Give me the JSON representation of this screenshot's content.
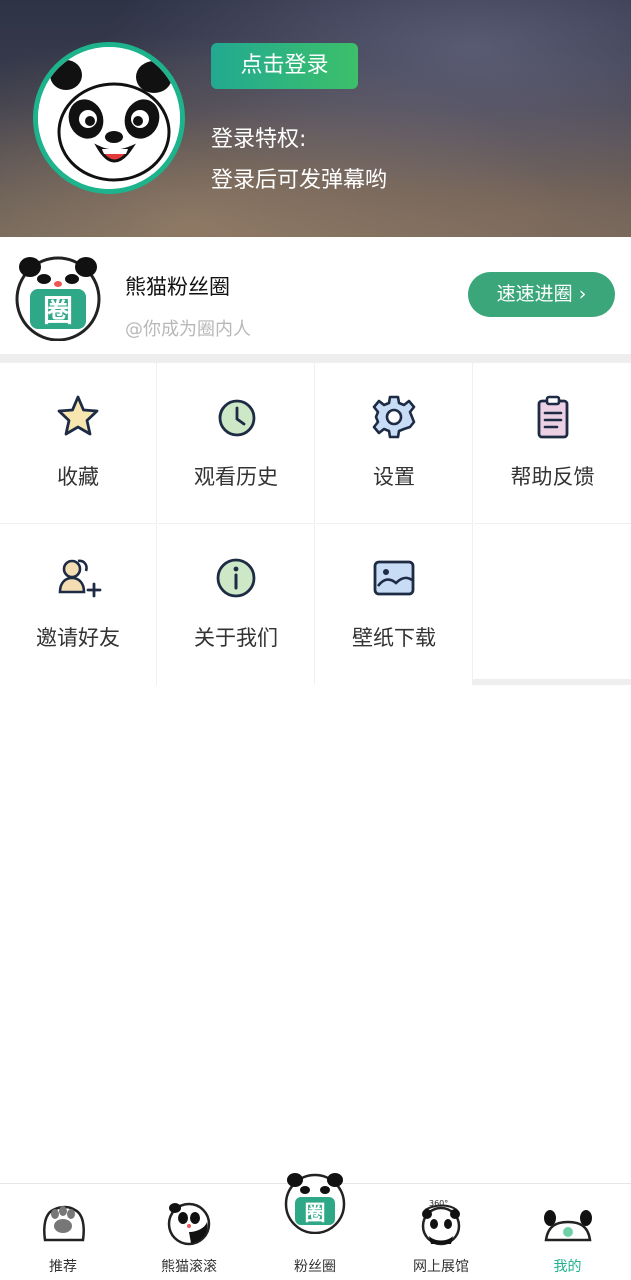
{
  "header": {
    "login_button": "点击登录",
    "privilege_title": "登录特权:",
    "privilege_desc": "登录后可发弹幕哟",
    "avatar_icon": "panda-face-icon"
  },
  "fan_circle": {
    "title": "熊猫粉丝圈",
    "subtitle": "@你成为圈内人",
    "button": "速速进圈",
    "logo_icon": "panda-quan-logo",
    "logo_text": "圈"
  },
  "grid": [
    {
      "label": "收藏",
      "icon": "star-icon"
    },
    {
      "label": "观看历史",
      "icon": "history-clock-icon"
    },
    {
      "label": "设置",
      "icon": "gear-icon"
    },
    {
      "label": "帮助反馈",
      "icon": "clipboard-icon"
    },
    {
      "label": "邀请好友",
      "icon": "invite-user-icon"
    },
    {
      "label": "关于我们",
      "icon": "info-icon"
    },
    {
      "label": "壁纸下载",
      "icon": "wallpaper-image-icon"
    }
  ],
  "bottom_nav": [
    {
      "label": "推荐",
      "icon": "panda-paw-icon",
      "active": false
    },
    {
      "label": "熊猫滚滚",
      "icon": "rolling-panda-icon",
      "active": false
    },
    {
      "label": "粉丝圈",
      "icon": "panda-quan-logo",
      "active": false
    },
    {
      "label": "网上展馆",
      "icon": "panda-360-icon",
      "active": false
    },
    {
      "label": "我的",
      "icon": "panda-me-icon",
      "active": true
    }
  ],
  "colors": {
    "accent": "#1db38c",
    "fan_button": "#3aa679",
    "separator": "#eeeeee"
  }
}
